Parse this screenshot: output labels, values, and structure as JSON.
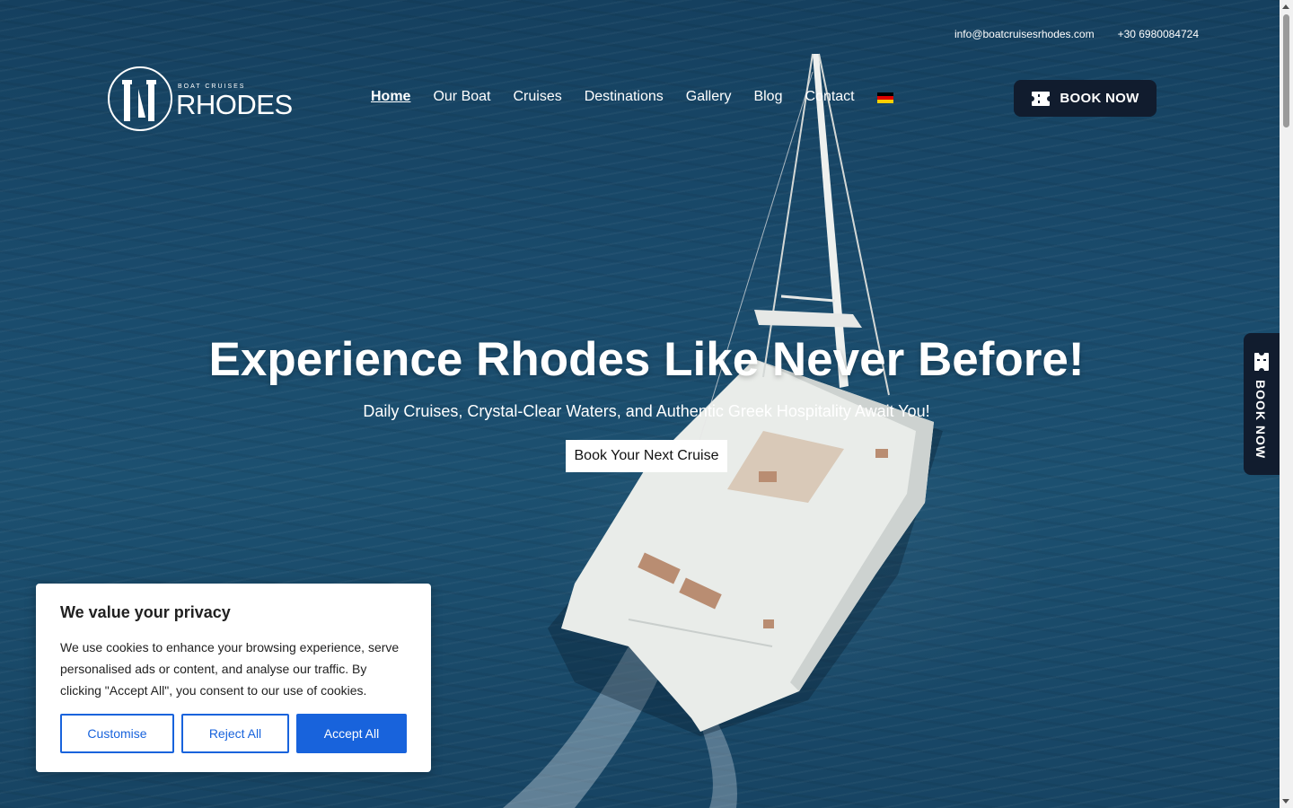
{
  "topbar": {
    "email": "info@boatcruisesrhodes.com",
    "phone": "+30 6980084724"
  },
  "logo": {
    "small_text": "BOAT CRUISES",
    "big_text": "RHODES"
  },
  "nav": {
    "items": [
      {
        "label": "Home",
        "active": true
      },
      {
        "label": "Our Boat"
      },
      {
        "label": "Cruises"
      },
      {
        "label": "Destinations"
      },
      {
        "label": "Gallery"
      },
      {
        "label": "Blog"
      },
      {
        "label": "Contact"
      }
    ],
    "language_flag": "german-flag-icon",
    "book_label": "BOOK NOW"
  },
  "hero": {
    "title": "Experience Rhodes Like Never Before!",
    "subtitle": "Daily Cruises, Crystal-Clear Waters, and Authentic Greek Hospitality Await You!",
    "cta": "Book Your Next Cruise"
  },
  "side_tab": {
    "label": "BOOK NOW"
  },
  "cookie": {
    "title": "We value your privacy",
    "body": "We use cookies to enhance your browsing experience, serve personalised ads or content, and analyse our traffic. By clicking \"Accept All\", you consent to our use of cookies.",
    "customise": "Customise",
    "reject": "Reject All",
    "accept": "Accept All"
  },
  "colors": {
    "accent": "#1863dc",
    "dark_button": "#111c2e",
    "sea": "#1a4b6c"
  }
}
